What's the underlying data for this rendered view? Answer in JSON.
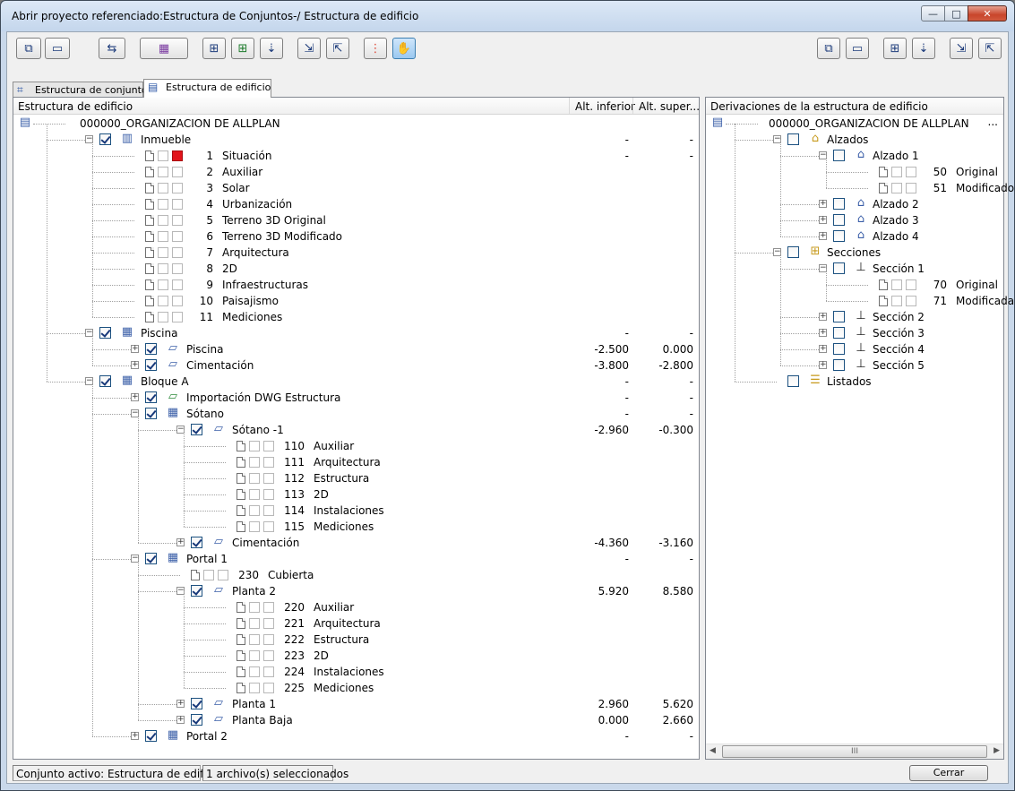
{
  "window": {
    "title": "Abrir proyecto referenciado:Estructura de Conjuntos-/ Estructura de edificio",
    "minimize_glyph": "—",
    "maximize_glyph": "□",
    "close_glyph": "✕"
  },
  "tabs": [
    {
      "label": "Estructura de conjuntos",
      "active": false
    },
    {
      "label": "Estructura de edificio",
      "active": true
    }
  ],
  "left_panel": {
    "col_name": "Estructura de edificio",
    "col_lower": "Alt. inferior",
    "col_upper": "Alt. super...",
    "tree": [
      {
        "level": 0,
        "type": "root",
        "label": "000000_ORGANIZACION DE ALLPLAN"
      },
      {
        "level": 1,
        "type": "node",
        "icon": "building-icon",
        "checked": true,
        "expander": "minus",
        "label": "Inmueble",
        "v1": "-",
        "v2": "-"
      },
      {
        "level": 2,
        "type": "file",
        "num": "1",
        "label": "Situación",
        "red": true,
        "v1": "-",
        "v2": "-"
      },
      {
        "level": 2,
        "type": "file",
        "num": "2",
        "label": "Auxiliar"
      },
      {
        "level": 2,
        "type": "file",
        "num": "3",
        "label": "Solar"
      },
      {
        "level": 2,
        "type": "file",
        "num": "4",
        "label": "Urbanización"
      },
      {
        "level": 2,
        "type": "file",
        "num": "5",
        "label": "Terreno 3D Original"
      },
      {
        "level": 2,
        "type": "file",
        "num": "6",
        "label": "Terreno 3D Modificado"
      },
      {
        "level": 2,
        "type": "file",
        "num": "7",
        "label": "Arquitectura"
      },
      {
        "level": 2,
        "type": "file",
        "num": "8",
        "label": "2D"
      },
      {
        "level": 2,
        "type": "file",
        "num": "9",
        "label": "Infraestructuras"
      },
      {
        "level": 2,
        "type": "file",
        "num": "10",
        "label": "Paisajismo"
      },
      {
        "level": 2,
        "type": "file",
        "num": "11",
        "label": "Mediciones"
      },
      {
        "level": 1,
        "type": "node",
        "icon": "structure-icon",
        "checked": true,
        "expander": "minus",
        "label": "Piscina",
        "v1": "-",
        "v2": "-"
      },
      {
        "level": 2,
        "type": "node",
        "icon": "floor-icon",
        "checked": true,
        "expander": "plus",
        "label": "Piscina",
        "v1": "-2.500",
        "v2": "0.000"
      },
      {
        "level": 2,
        "type": "node",
        "icon": "floor-icon",
        "checked": true,
        "expander": "plus",
        "label": "Cimentación",
        "v1": "-3.800",
        "v2": "-2.800"
      },
      {
        "level": 1,
        "type": "node",
        "icon": "structure-icon",
        "checked": true,
        "expander": "minus",
        "label": "Bloque A",
        "v1": "-",
        "v2": "-"
      },
      {
        "level": 2,
        "type": "node",
        "icon": "dwg-floor-icon",
        "checked": true,
        "expander": "plus",
        "label": "Importación DWG Estructura",
        "v1": "-",
        "v2": "-"
      },
      {
        "level": 2,
        "type": "node",
        "icon": "structure-icon",
        "checked": true,
        "expander": "minus",
        "label": "Sótano",
        "v1": "-",
        "v2": "-"
      },
      {
        "level": 3,
        "type": "node",
        "icon": "floor-icon",
        "checked": true,
        "expander": "minus",
        "label": "Sótano -1",
        "v1": "-2.960",
        "v2": "-0.300"
      },
      {
        "level": 4,
        "type": "file",
        "num": "110",
        "label": "Auxiliar"
      },
      {
        "level": 4,
        "type": "file",
        "num": "111",
        "label": "Arquitectura"
      },
      {
        "level": 4,
        "type": "file",
        "num": "112",
        "label": "Estructura"
      },
      {
        "level": 4,
        "type": "file",
        "num": "113",
        "label": "2D"
      },
      {
        "level": 4,
        "type": "file",
        "num": "114",
        "label": "Instalaciones"
      },
      {
        "level": 4,
        "type": "file",
        "num": "115",
        "label": "Mediciones"
      },
      {
        "level": 3,
        "type": "node",
        "icon": "floor-icon",
        "checked": true,
        "expander": "plus",
        "label": "Cimentación",
        "v1": "-4.360",
        "v2": "-3.160"
      },
      {
        "level": 2,
        "type": "node",
        "icon": "structure-icon",
        "checked": true,
        "expander": "minus",
        "label": "Portal 1",
        "v1": "-",
        "v2": "-"
      },
      {
        "level": 3,
        "type": "file",
        "num": "230",
        "label": "Cubierta"
      },
      {
        "level": 3,
        "type": "node",
        "icon": "floor-icon",
        "checked": true,
        "expander": "minus",
        "label": "Planta 2",
        "v1": "5.920",
        "v2": "8.580"
      },
      {
        "level": 4,
        "type": "file",
        "num": "220",
        "label": "Auxiliar"
      },
      {
        "level": 4,
        "type": "file",
        "num": "221",
        "label": "Arquitectura"
      },
      {
        "level": 4,
        "type": "file",
        "num": "222",
        "label": "Estructura"
      },
      {
        "level": 4,
        "type": "file",
        "num": "223",
        "label": "2D"
      },
      {
        "level": 4,
        "type": "file",
        "num": "224",
        "label": "Instalaciones"
      },
      {
        "level": 4,
        "type": "file",
        "num": "225",
        "label": "Mediciones"
      },
      {
        "level": 3,
        "type": "node",
        "icon": "floor-icon",
        "checked": true,
        "expander": "plus",
        "label": "Planta 1",
        "v1": "2.960",
        "v2": "5.620"
      },
      {
        "level": 3,
        "type": "node",
        "icon": "floor-icon",
        "checked": true,
        "expander": "plus",
        "label": "Planta Baja",
        "v1": "0.000",
        "v2": "2.660"
      },
      {
        "level": 2,
        "type": "node",
        "icon": "structure-icon",
        "checked": true,
        "expander": "plus",
        "label": "Portal 2",
        "v1": "-",
        "v2": "-"
      }
    ]
  },
  "right_panel": {
    "col_name": "Derivaciones de la estructura de edificio",
    "more": "...",
    "tree": [
      {
        "level": 0,
        "type": "root",
        "label": "000000_ORGANIZACION DE ALLPLAN"
      },
      {
        "level": 1,
        "type": "node",
        "icon": "folder-house-icon",
        "checked": false,
        "expander": "minus",
        "label": "Alzados"
      },
      {
        "level": 2,
        "type": "node",
        "icon": "house-icon",
        "checked": false,
        "expander": "minus",
        "label": "Alzado 1"
      },
      {
        "level": 3,
        "type": "file",
        "num": "50",
        "label": "Original"
      },
      {
        "level": 3,
        "type": "file",
        "num": "51",
        "label": "Modificado"
      },
      {
        "level": 2,
        "type": "node",
        "icon": "house-icon",
        "checked": false,
        "expander": "plus",
        "label": "Alzado 2"
      },
      {
        "level": 2,
        "type": "node",
        "icon": "house-icon",
        "checked": false,
        "expander": "plus",
        "label": "Alzado 3"
      },
      {
        "level": 2,
        "type": "node",
        "icon": "house-icon",
        "checked": false,
        "expander": "plus",
        "label": "Alzado 4"
      },
      {
        "level": 1,
        "type": "node",
        "icon": "folder-section-icon",
        "checked": false,
        "expander": "minus",
        "label": "Secciones"
      },
      {
        "level": 2,
        "type": "node",
        "icon": "section-icon",
        "checked": false,
        "expander": "minus",
        "label": "Sección 1"
      },
      {
        "level": 3,
        "type": "file",
        "num": "70",
        "label": "Original"
      },
      {
        "level": 3,
        "type": "file",
        "num": "71",
        "label": "Modificada"
      },
      {
        "level": 2,
        "type": "node",
        "icon": "section-icon",
        "checked": false,
        "expander": "plus",
        "label": "Sección 2"
      },
      {
        "level": 2,
        "type": "node",
        "icon": "section-icon",
        "checked": false,
        "expander": "plus",
        "label": "Sección 3"
      },
      {
        "level": 2,
        "type": "node",
        "icon": "section-icon",
        "checked": false,
        "expander": "plus",
        "label": "Sección 4"
      },
      {
        "level": 2,
        "type": "node",
        "icon": "section-icon",
        "checked": false,
        "expander": "plus",
        "label": "Sección 5"
      },
      {
        "level": 1,
        "type": "node",
        "icon": "folder-list-icon",
        "checked": false,
        "expander": "none",
        "label": "Listados"
      }
    ],
    "scroll_thumb": "III"
  },
  "status": {
    "active_set": "Conjunto activo: Estructura de edificio",
    "selection": "1 archivo(s) seleccionados",
    "close_button": "Cerrar"
  },
  "toolbar_icons": [
    "add-structure-icon",
    "remove-structure-icon",
    "refresh-icon",
    "assign-icon",
    "insert-level-icon",
    "insert-sublevel-icon",
    "move-down-icon",
    "import-icon",
    "export-icon",
    "settings-icon",
    "active-mode-icon",
    "add-derivation-icon",
    "remove-derivation-icon",
    "insert-derivation-icon",
    "move-derivation-icon",
    "import-derivation-icon",
    "export-derivation-icon"
  ],
  "colors": {
    "titlebar": "#c4d6ec",
    "close_button": "#c8452b",
    "checkbox_border": "#1c5180",
    "red_file": "#e2141b"
  }
}
